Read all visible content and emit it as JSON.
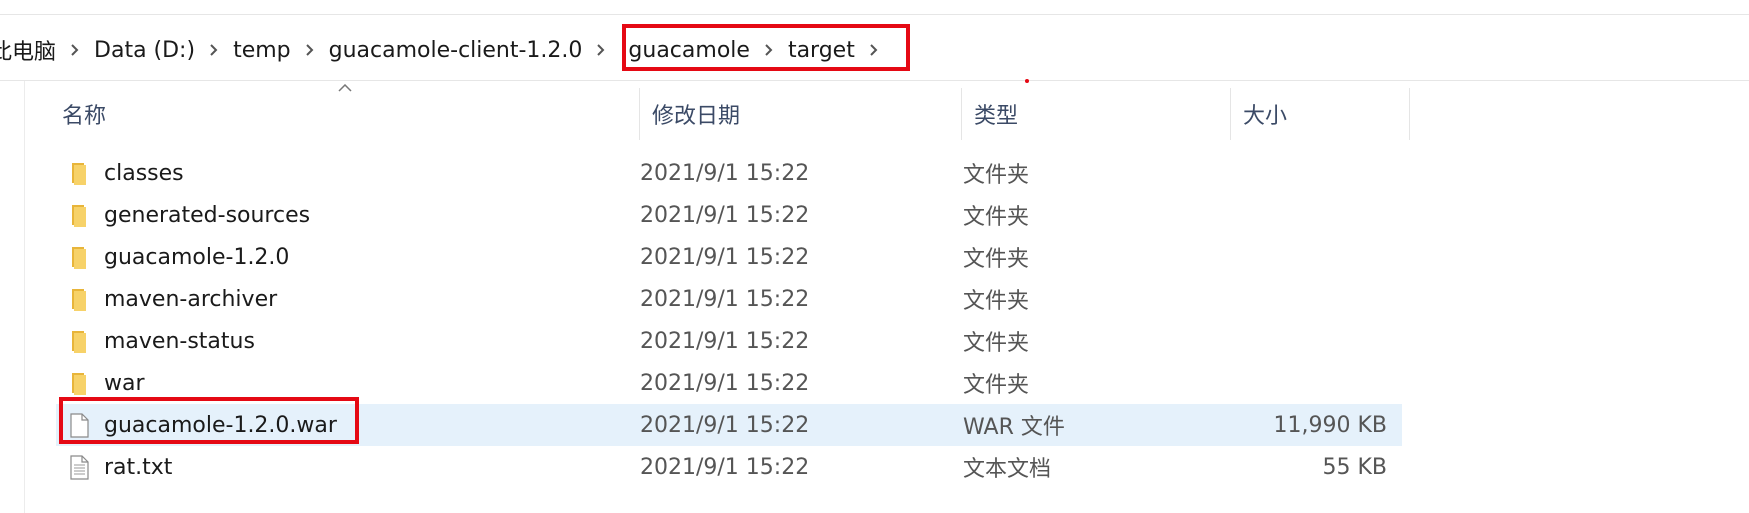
{
  "breadcrumb": {
    "items": [
      "此电脑",
      "Data (D:)",
      "temp",
      "guacamole-client-1.2.0",
      "guacamole",
      "target"
    ]
  },
  "columns": {
    "name": "名称",
    "date": "修改日期",
    "type": "类型",
    "size": "大小"
  },
  "files": [
    {
      "name": "classes",
      "date": "2021/9/1 15:22",
      "type": "文件夹",
      "size": "",
      "icon": "folder-icon"
    },
    {
      "name": "generated-sources",
      "date": "2021/9/1 15:22",
      "type": "文件夹",
      "size": "",
      "icon": "folder-icon"
    },
    {
      "name": "guacamole-1.2.0",
      "date": "2021/9/1 15:22",
      "type": "文件夹",
      "size": "",
      "icon": "folder-icon"
    },
    {
      "name": "maven-archiver",
      "date": "2021/9/1 15:22",
      "type": "文件夹",
      "size": "",
      "icon": "folder-icon"
    },
    {
      "name": "maven-status",
      "date": "2021/9/1 15:22",
      "type": "文件夹",
      "size": "",
      "icon": "folder-icon"
    },
    {
      "name": "war",
      "date": "2021/9/1 15:22",
      "type": "文件夹",
      "size": "",
      "icon": "folder-icon"
    },
    {
      "name": "guacamole-1.2.0.war",
      "date": "2021/9/1 15:22",
      "type": "WAR 文件",
      "size": "11,990 KB",
      "icon": "file-icon"
    },
    {
      "name": "rat.txt",
      "date": "2021/9/1 15:22",
      "type": "文本文档",
      "size": "55 KB",
      "icon": "text-file-icon"
    }
  ],
  "colors": {
    "highlight": "#e50914",
    "selected_row": "#e5f1fb",
    "folder": "#f4c542"
  }
}
